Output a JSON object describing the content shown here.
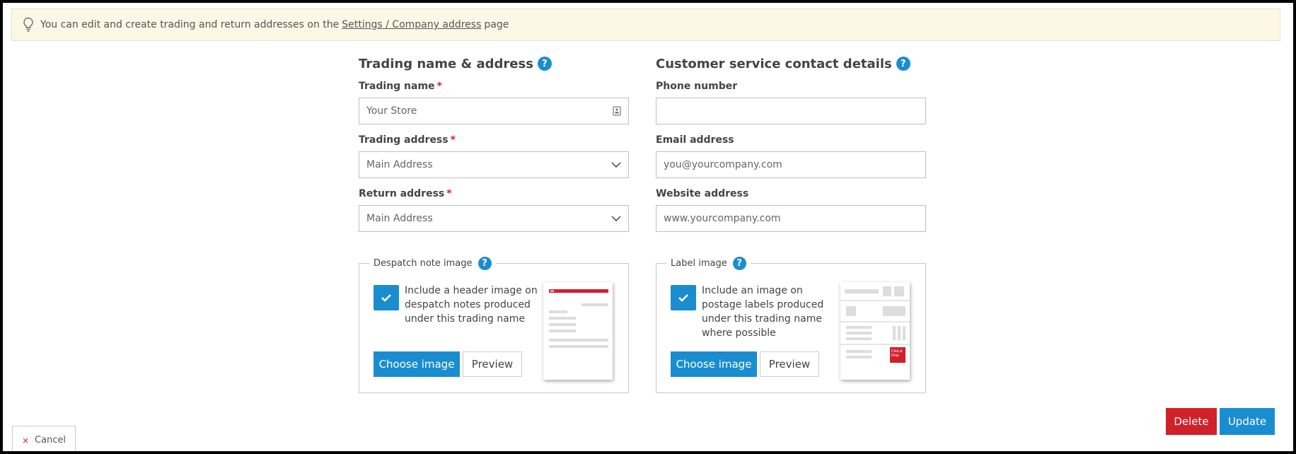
{
  "notice": {
    "text_before": "You can edit and create trading and return addresses on the",
    "link": "Settings / Company address",
    "text_after": "page"
  },
  "trading": {
    "title": "Trading name & address",
    "help": "?",
    "trading_name_label": "Trading name",
    "trading_name_value": "Your Store",
    "trading_address_label": "Trading address",
    "trading_address_value": "Main Address",
    "return_address_label": "Return address",
    "return_address_value": "Main Address",
    "required_mark": "*"
  },
  "customer": {
    "title": "Customer service contact details",
    "help": "?",
    "phone_label": "Phone number",
    "phone_value": "",
    "email_label": "Email address",
    "email_placeholder": "you@yourcompany.com",
    "website_label": "Website address",
    "website_placeholder": "www.yourcompany.com"
  },
  "despatch": {
    "legend": "Despatch note image",
    "help": "?",
    "checkbox_text": "Include a header image on despatch notes produced under this trading name",
    "checked": true,
    "choose_label": "Choose image",
    "preview_label": "Preview"
  },
  "label_image": {
    "legend": "Label image",
    "help": "?",
    "checkbox_text": "Include an image on postage labels produced under this trading name where possible",
    "checked": true,
    "choose_label": "Choose image",
    "preview_label": "Preview",
    "logo_text": "Click & Drop"
  },
  "actions": {
    "delete_label": "Delete",
    "update_label": "Update",
    "cancel_label": "Cancel",
    "cancel_icon": "×"
  },
  "colors": {
    "accent": "#1a8dd0",
    "danger": "#d0212b",
    "notice_bg": "#fcf8e6"
  }
}
